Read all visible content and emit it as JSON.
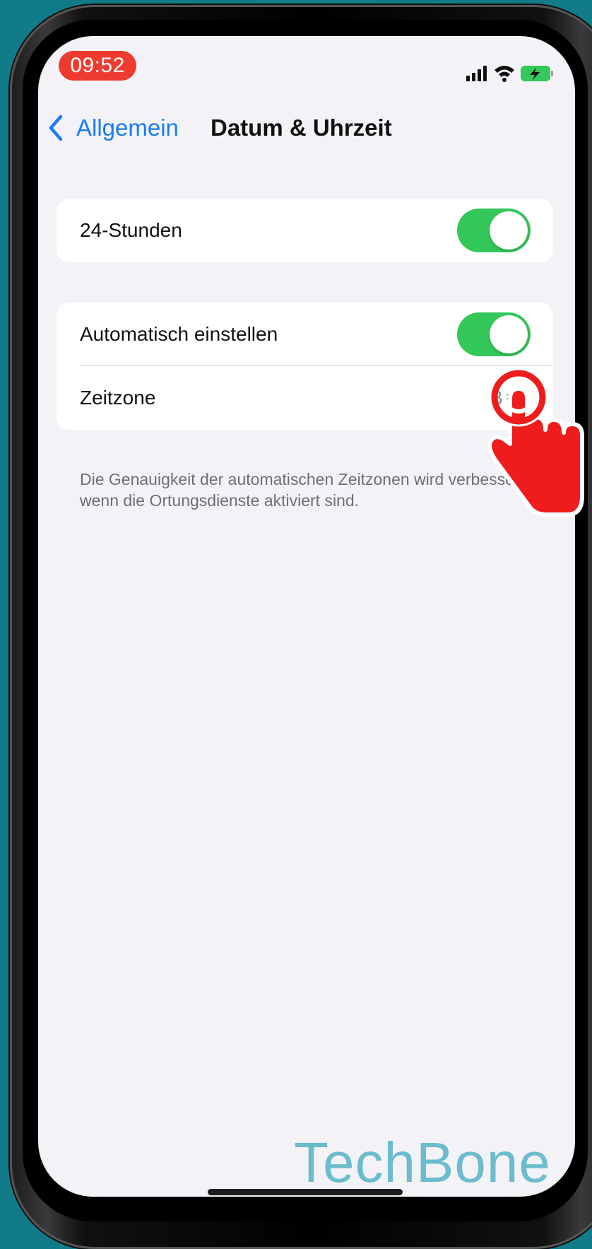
{
  "status_bar": {
    "time": "09:52",
    "icons": [
      "signal-icon",
      "wifi-icon",
      "battery-charging-icon"
    ]
  },
  "nav": {
    "back_label": "Allgemein",
    "title": "Datum & Uhrzeit"
  },
  "group1": {
    "rows": [
      {
        "label": "24-Stunden",
        "toggle_on": true
      }
    ]
  },
  "group2": {
    "rows": [
      {
        "label": "Automatisch einstellen",
        "toggle_on": true
      },
      {
        "label": "Zeitzone",
        "value": "Berl"
      }
    ],
    "footnote": "Die Genauigkeit der automatischen Zeitzonen wird verbessert, wenn die Ortungsdienste aktiviert sind."
  },
  "watermark": "TechBone",
  "colors": {
    "accent": "#1a7cf2",
    "toggle_on": "#34c759",
    "time_pill": "#ef3b2f",
    "pointer": "#ee1c1c",
    "background": "#117b89"
  }
}
